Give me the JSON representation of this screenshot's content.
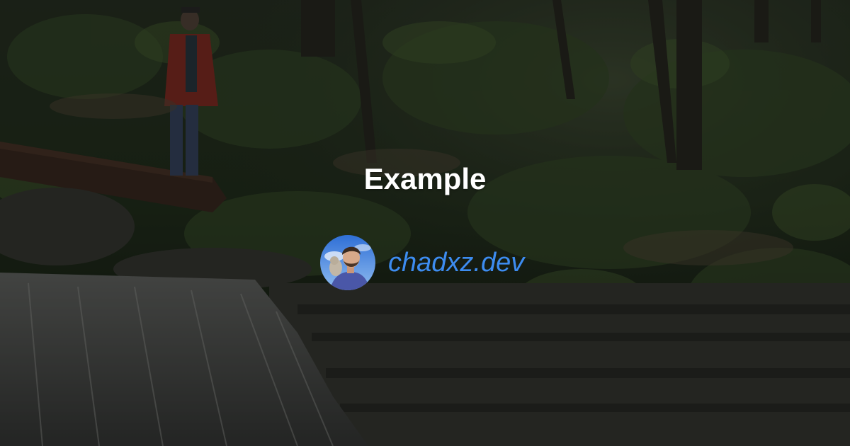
{
  "card": {
    "title": "Example",
    "site": "chadxz.dev"
  },
  "colors": {
    "title": "#ffffff",
    "link": "#3d8cf0",
    "background_tint": "#1a2016"
  },
  "icons": {
    "avatar": "author-avatar-photo"
  }
}
